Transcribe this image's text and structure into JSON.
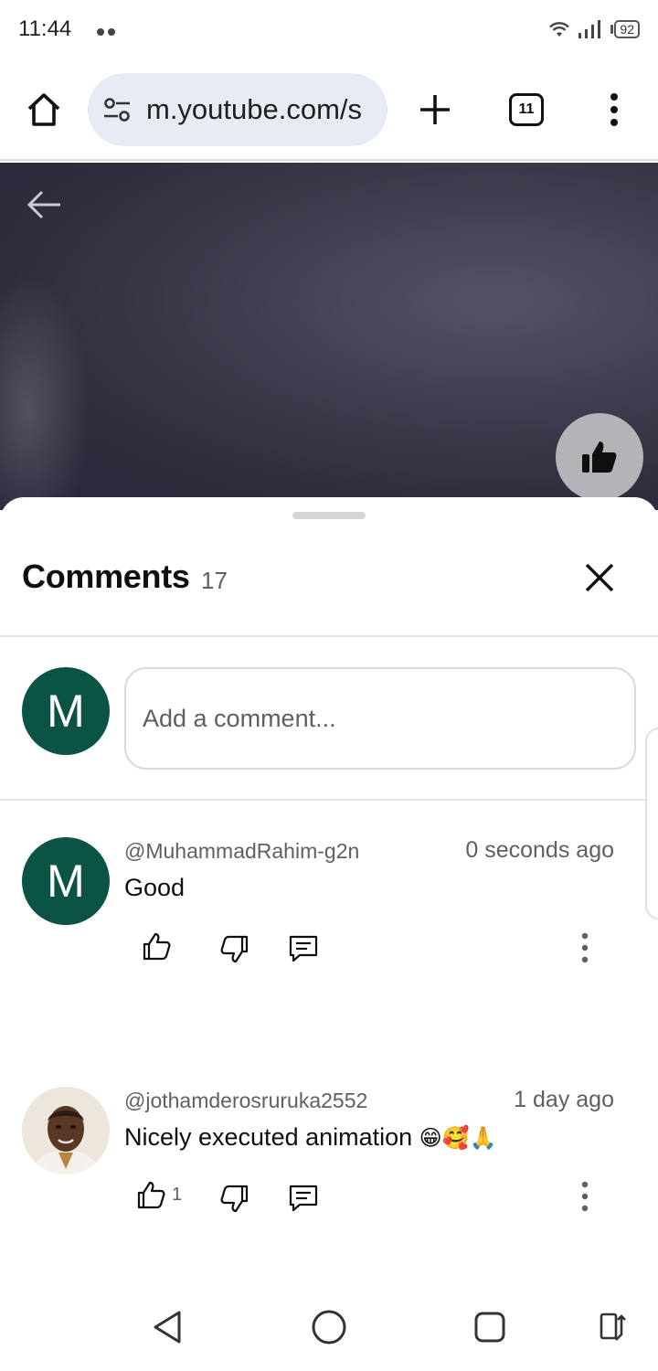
{
  "status_bar": {
    "time": "11:44",
    "battery": "92"
  },
  "browser": {
    "url": "m.youtube.com/s",
    "tab_count": "11"
  },
  "comments": {
    "title": "Comments",
    "count": "17",
    "input_placeholder": "Add a comment...",
    "current_user_initial": "M",
    "items": [
      {
        "avatar_initial": "M",
        "author": "@MuhammadRahim-g2n",
        "time": "0 seconds ago",
        "text": "Good",
        "likes": ""
      },
      {
        "author": "@jothamderosruruka2552",
        "time": "1 day ago",
        "text": "Nicely executed animation ",
        "emojis": "😁🥰🙏",
        "likes": "1"
      }
    ]
  },
  "icons": {
    "home": "home-icon",
    "tune": "tune-icon",
    "new_tab": "plus-icon",
    "menu": "more-vert-icon",
    "back": "arrow-back-icon",
    "like": "thumb-up-icon",
    "dislike": "thumb-down-icon",
    "reply": "comment-icon",
    "close": "close-icon"
  },
  "colors": {
    "avatar_green": "#0b5345",
    "url_pill": "#e6ebf4",
    "secondary_text": "#606060"
  }
}
